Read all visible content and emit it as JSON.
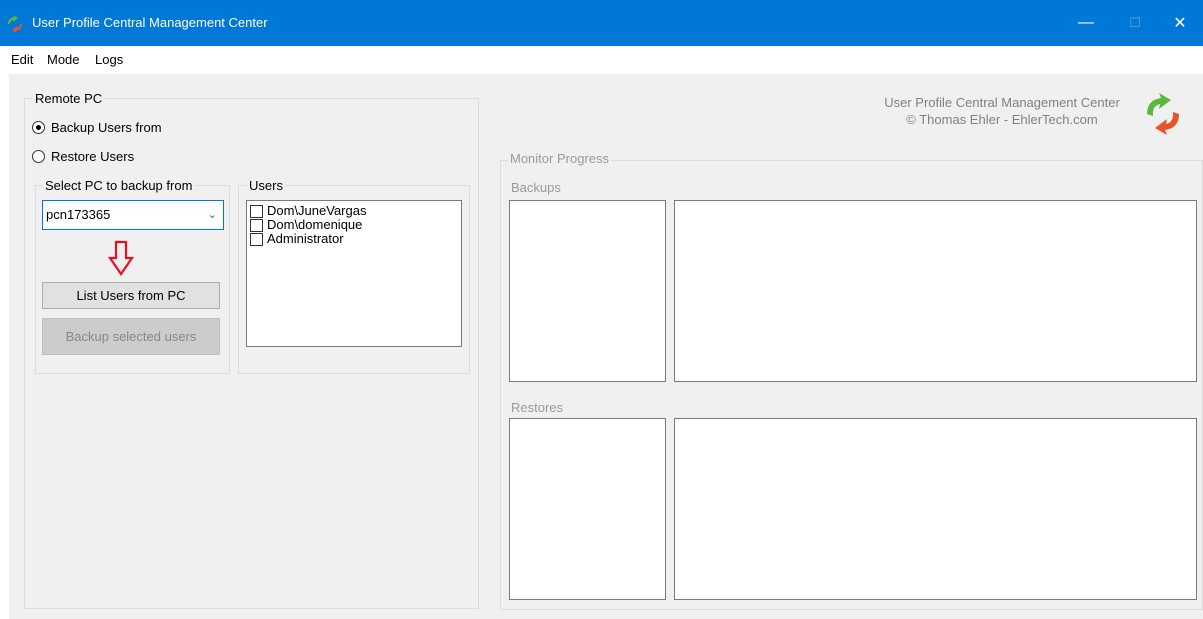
{
  "window": {
    "title": "User Profile Central Management Center",
    "controls": {
      "minimize": "—",
      "maximize": "☐",
      "close": "✕"
    }
  },
  "menu": {
    "items": [
      "Edit",
      "Mode",
      "Logs"
    ]
  },
  "remote_pc": {
    "group_label": "Remote PC",
    "radio_backup": "Backup Users from",
    "radio_restore": "Restore Users",
    "selected_mode": "backup",
    "select_pc": {
      "label": "Select PC to backup from",
      "value": "pcn173365"
    },
    "list_users_button": "List Users from PC",
    "backup_selected_button": "Backup selected users",
    "users": {
      "label": "Users",
      "items": [
        "Dom\\JuneVargas",
        "Dom\\domenique",
        "Administrator"
      ]
    }
  },
  "branding": {
    "line1": "User Profile Central Management Center",
    "line2": "© Thomas Ehler - EhlerTech.com"
  },
  "monitor": {
    "label": "Monitor Progress",
    "backups_label": "Backups",
    "restores_label": "Restores"
  },
  "colors": {
    "titlebar": "#0078d7",
    "arrow_red": "#e81123",
    "logo_green": "#5cb83c",
    "logo_orange": "#e8532a"
  }
}
